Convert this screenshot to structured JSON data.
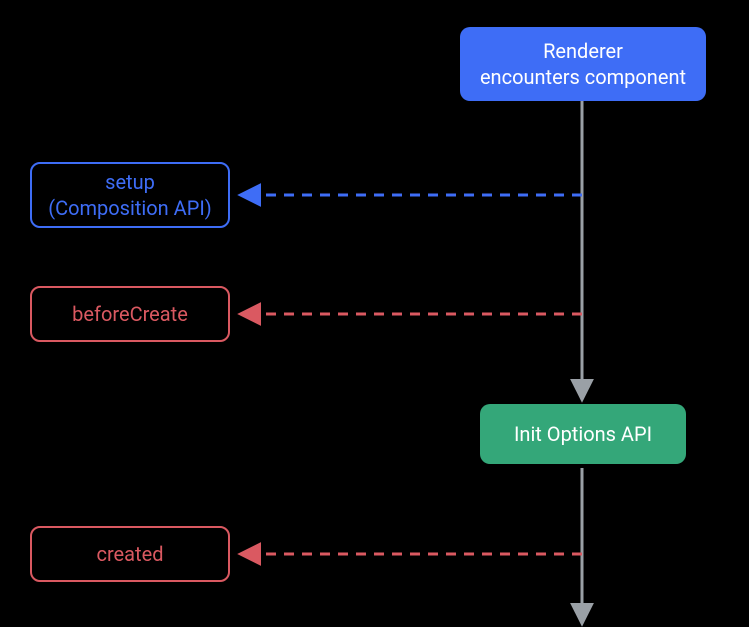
{
  "colors": {
    "blue": "#3e6df6",
    "red": "#da5961",
    "green": "#34a779",
    "grey": "#9aa0a6"
  },
  "nodes": {
    "renderer": {
      "line1": "Renderer",
      "line2": "encounters component"
    },
    "setup": {
      "line1": "setup",
      "line2": "(Composition API)"
    },
    "beforeCreate": {
      "label": "beforeCreate"
    },
    "initOptions": {
      "label": "Init Options API"
    },
    "created": {
      "label": "created"
    }
  }
}
